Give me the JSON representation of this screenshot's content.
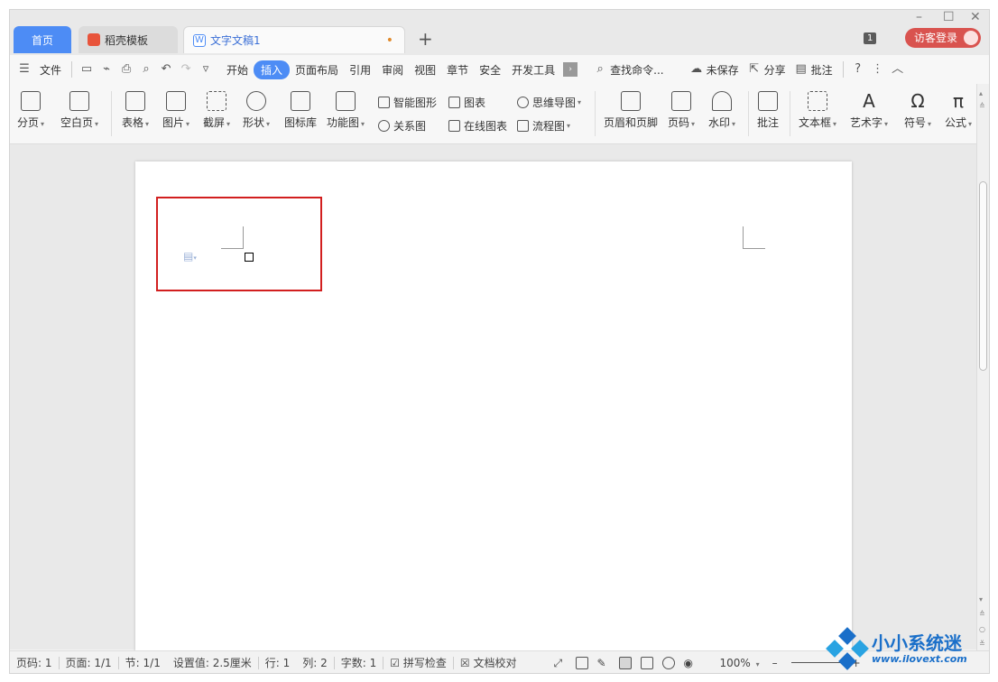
{
  "tabs": {
    "home": "首页",
    "template": "稻壳模板",
    "document": "文字文稿1",
    "doc_modified_dot": "•",
    "add": "+"
  },
  "window": {
    "minimize": "–",
    "maximize": "☐",
    "close": "✕",
    "badge": "1",
    "login": "访客登录"
  },
  "menu": {
    "file": "文件",
    "items": [
      "开始",
      "插入",
      "页面布局",
      "引用",
      "审阅",
      "视图",
      "章节",
      "安全",
      "开发工具"
    ],
    "active": "插入",
    "search": "查找命令...",
    "unsaved": "未保存",
    "share": "分享",
    "comment": "批注",
    "help": "?",
    "more": "⋮",
    "collapse": "︿"
  },
  "ribbon": {
    "page_break": "分页",
    "blank_page": "空白页",
    "table": "表格",
    "picture": "图片",
    "screenshot": "截屏",
    "shape": "形状",
    "icon_library": "图标库",
    "function_chart": "功能图",
    "smart_art": "智能图形",
    "relation_chart": "关系图",
    "chart": "图表",
    "online_chart": "在线图表",
    "mind_map": "思维导图",
    "flow_chart": "流程图",
    "header_footer": "页眉和页脚",
    "page_number": "页码",
    "watermark": "水印",
    "comment": "批注",
    "text_box": "文本框",
    "word_art": "艺术字",
    "symbol": "符号",
    "formula": "公式"
  },
  "status": {
    "page_num": "页码: 1",
    "pages": "页面: 1/1",
    "section": "节: 1/1",
    "setting": "设置值: 2.5厘米",
    "row": "行: 1",
    "col": "列: 2",
    "words": "字数: 1",
    "spell": "拼写检查",
    "proof": "文档校对",
    "zoom": "100%",
    "zoom_out": "–",
    "zoom_in": "+"
  },
  "watermark": {
    "title": "小小系统迷",
    "url": "www.ilovext.com"
  },
  "colors": {
    "accent": "#4d8cf5",
    "highlight_box": "#d21f1f",
    "login": "#d9534f",
    "watermark": "#1a6fc9"
  }
}
